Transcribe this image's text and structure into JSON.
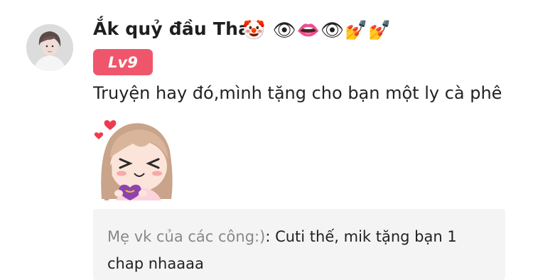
{
  "comment": {
    "username": "Ắk quỷ đầu Thai",
    "username_emojis": "🤡 👁👄👁💅💅",
    "level": "Lv9",
    "text": "Truyện hay đó,mình tặng cho bạn một ly cà phê",
    "sticker_icon": "girl-hugging-heart-sticker",
    "reply": {
      "author": "Mẹ vk của các công:)",
      "text": ": Cuti thế, mik tặng bạn 1 chap nhaaaa"
    }
  },
  "colors": {
    "level_badge": "#f0566b",
    "reply_bg": "#f4f4f4",
    "reply_author": "#888888"
  }
}
